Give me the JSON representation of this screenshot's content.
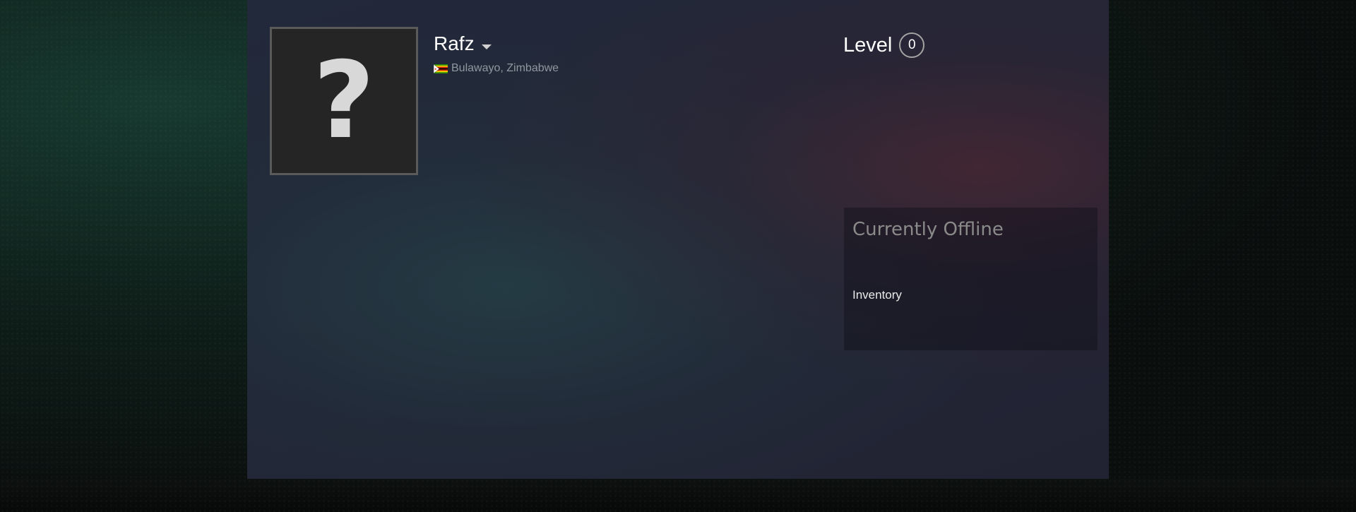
{
  "profile": {
    "persona_name": "Rafz",
    "location": "Bulawayo, Zimbabwe",
    "avatar_placeholder": "?",
    "level_label": "Level",
    "level_value": "0"
  },
  "sidebar": {
    "status": "Currently Offline",
    "inventory_label": "Inventory"
  },
  "colors": {
    "page_bg": "#0b0f0d",
    "panel_bg": "#232637",
    "status_text": "#8a8a8a",
    "muted_text": "#8f98a0"
  }
}
